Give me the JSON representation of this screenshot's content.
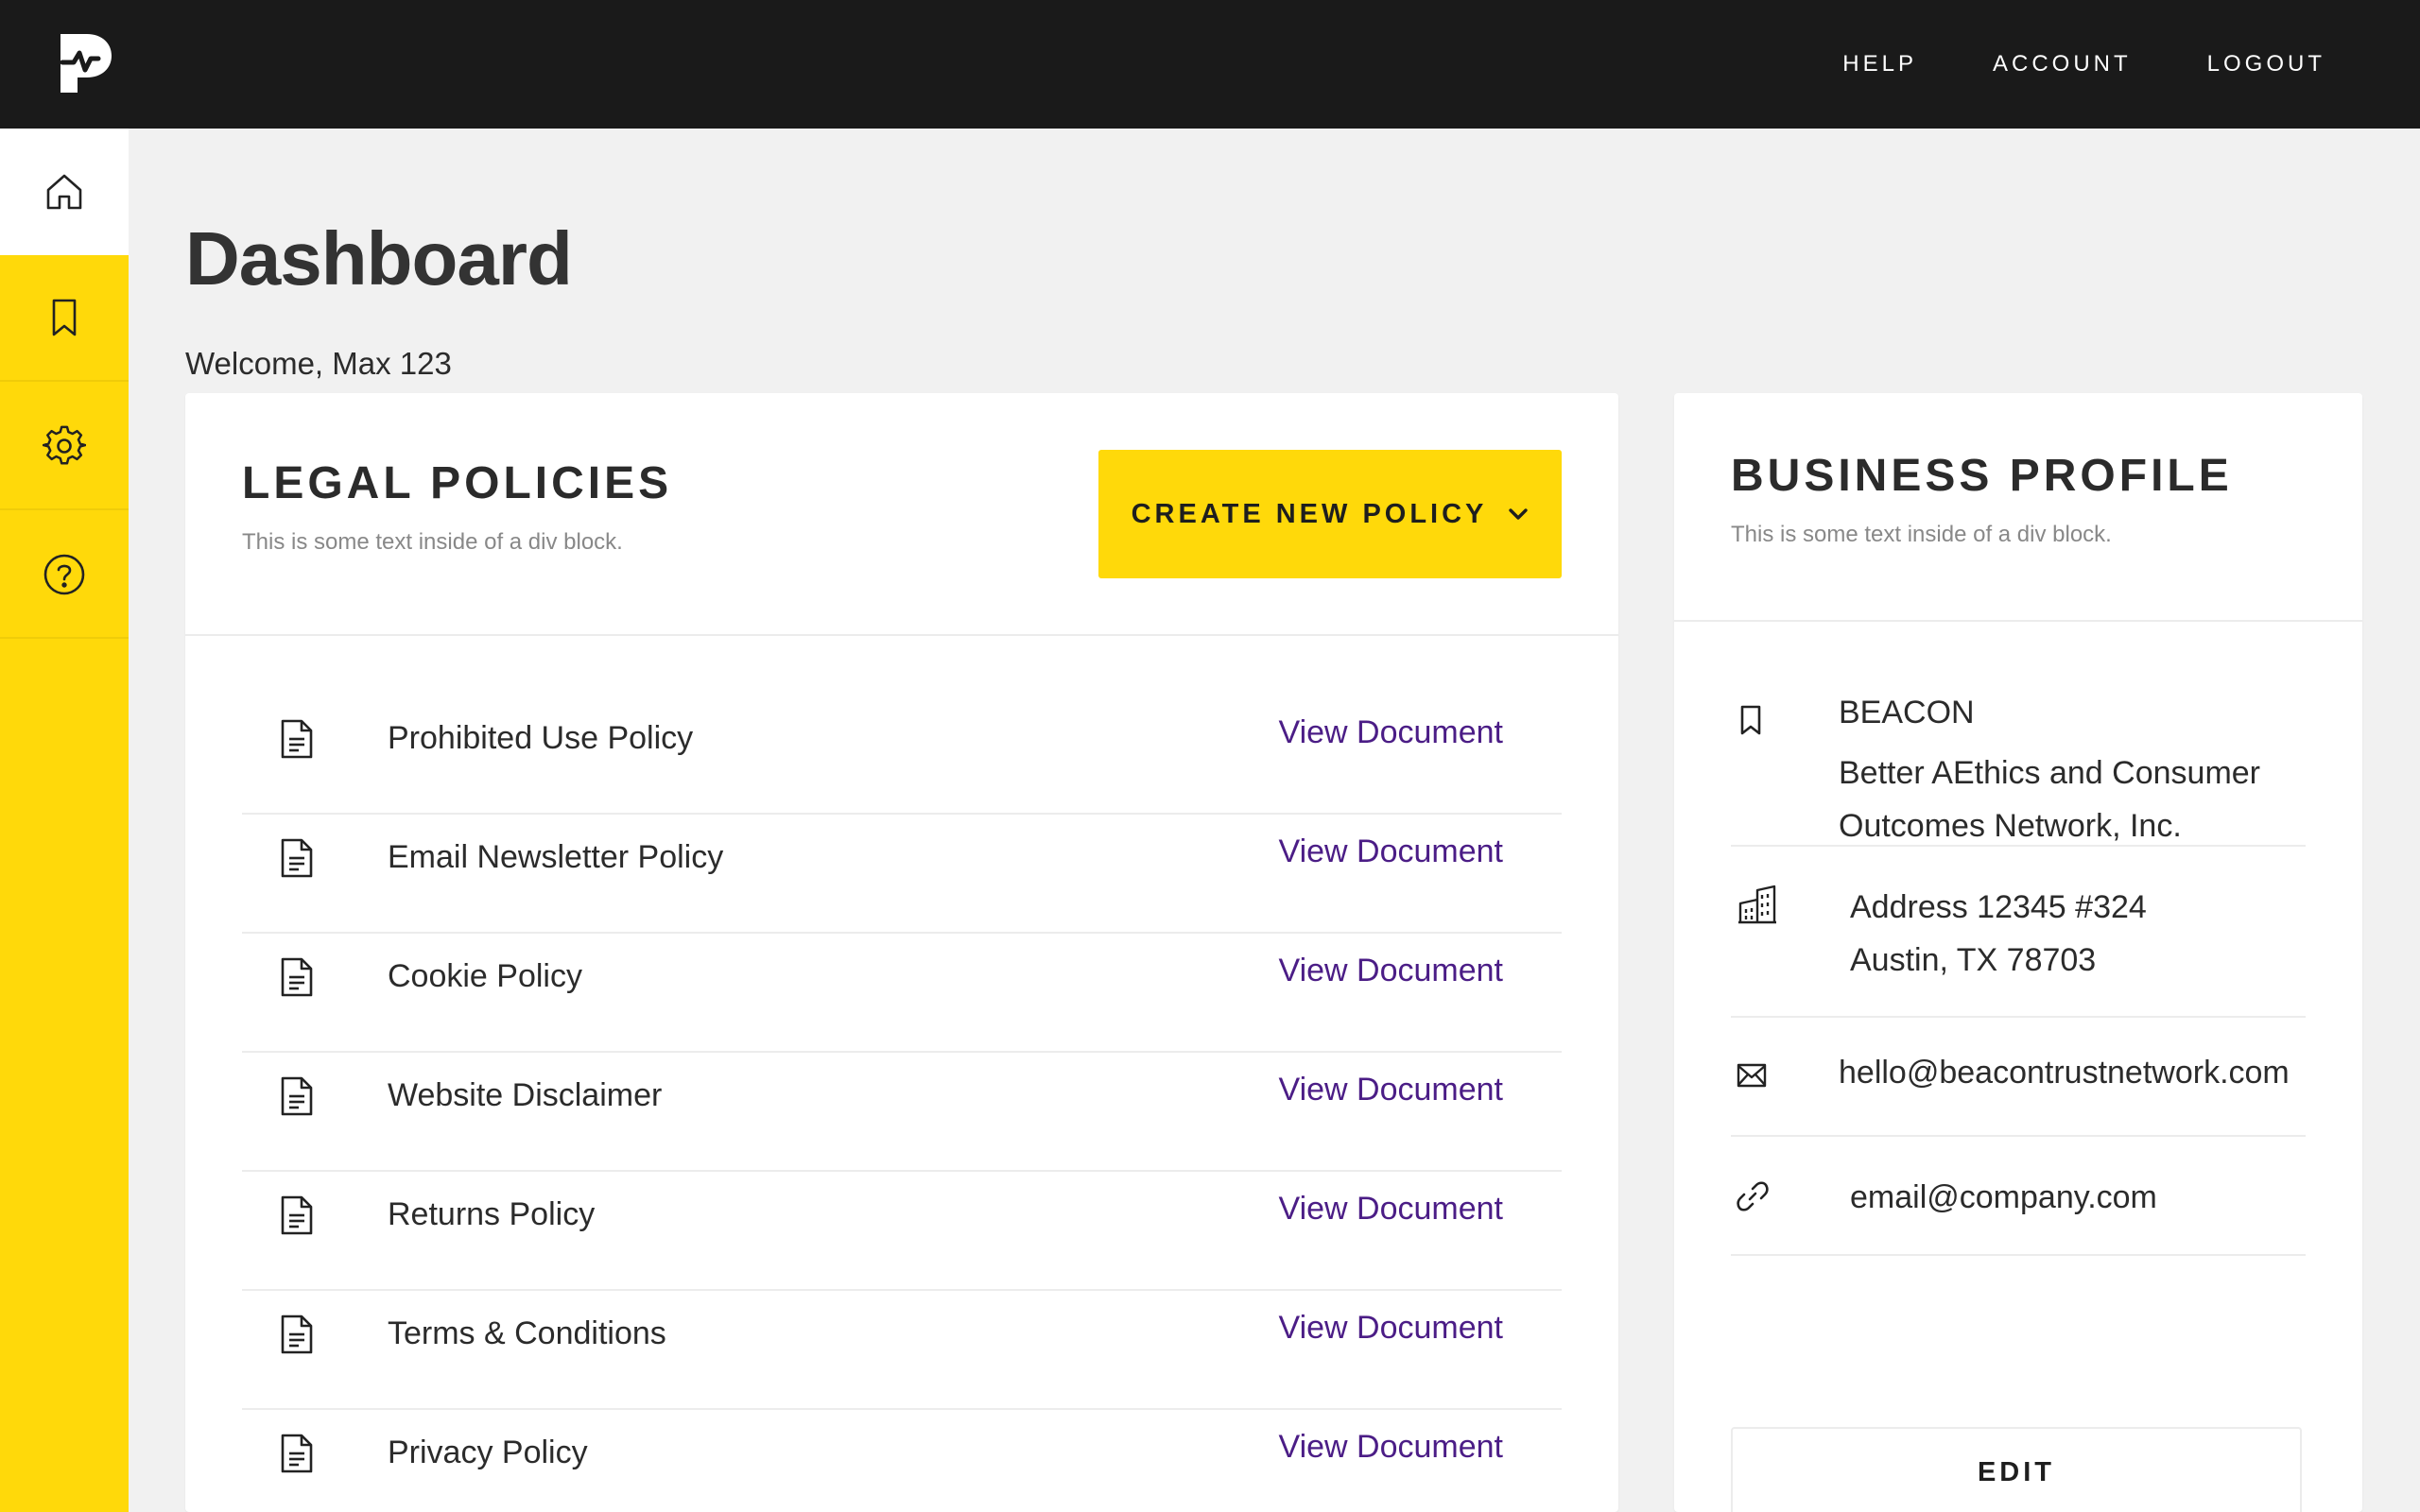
{
  "topnav": {
    "help": "HELP",
    "account": "ACCOUNT",
    "logout": "LOGOUT"
  },
  "sidebar": {
    "items": [
      {
        "icon": "home-icon",
        "active": true
      },
      {
        "icon": "bookmark-icon",
        "active": false
      },
      {
        "icon": "gear-icon",
        "active": false
      },
      {
        "icon": "help-circle-icon",
        "active": false
      }
    ]
  },
  "page": {
    "title": "Dashboard",
    "welcome": "Welcome, Max 123"
  },
  "policies": {
    "title": "LEGAL POLICIES",
    "subtitle": "This is some text inside of a div block.",
    "create_label": "CREATE NEW POLICY",
    "view_label": "View Document",
    "items": [
      {
        "name": "Prohibited Use Policy"
      },
      {
        "name": "Email Newsletter Policy"
      },
      {
        "name": "Cookie Policy"
      },
      {
        "name": "Website Disclaimer"
      },
      {
        "name": "Returns Policy"
      },
      {
        "name": "Terms & Conditions"
      },
      {
        "name": "Privacy Policy"
      }
    ]
  },
  "profile": {
    "title": "BUSINESS PROFILE",
    "subtitle": "This is some text inside of a div block.",
    "short_name": "BEACON",
    "legal_name_1": "Better AEthics and Consumer",
    "legal_name_2": "Outcomes Network, Inc.",
    "address_1": "Address 12345 #324",
    "address_2": "Austin, TX 78703",
    "email": "hello@beacontrustnetwork.com",
    "website": "email@company.com",
    "edit_label": "EDIT"
  },
  "colors": {
    "accent": "#ffd90a",
    "topbar": "#1a1a1a",
    "link": "#4b1d86",
    "background": "#f1f1f1"
  }
}
